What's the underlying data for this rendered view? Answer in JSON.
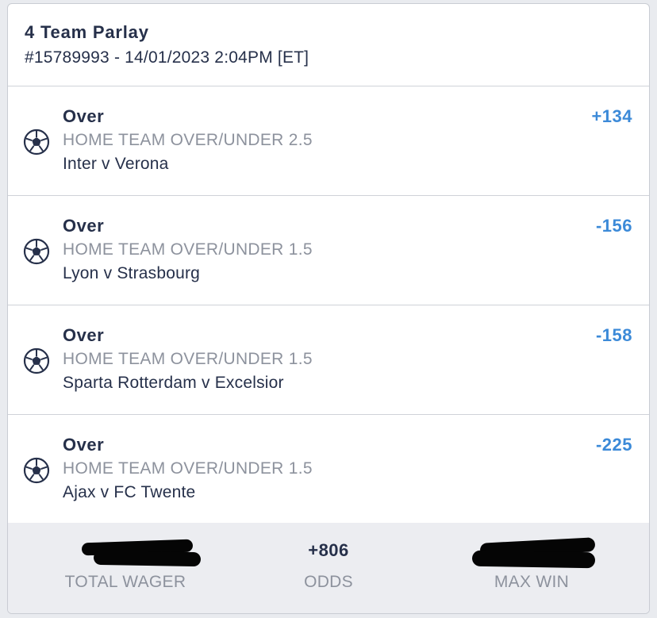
{
  "bet": {
    "title": "4 Team Parlay",
    "reference": "#15789993 - 14/01/2023 2:04PM [ET]"
  },
  "legs": [
    {
      "selection": "Over",
      "market": "HOME TEAM OVER/UNDER 2.5",
      "event": "Inter v Verona",
      "odds": "+134",
      "icon": "soccer-ball-icon"
    },
    {
      "selection": "Over",
      "market": "HOME TEAM OVER/UNDER 1.5",
      "event": "Lyon v Strasbourg",
      "odds": "-156",
      "icon": "soccer-ball-icon"
    },
    {
      "selection": "Over",
      "market": "HOME TEAM OVER/UNDER 1.5",
      "event": "Sparta Rotterdam v Excelsior",
      "odds": "-158",
      "icon": "soccer-ball-icon"
    },
    {
      "selection": "Over",
      "market": "HOME TEAM OVER/UNDER 1.5",
      "event": "Ajax v FC Twente",
      "odds": "-225",
      "icon": "soccer-ball-icon"
    }
  ],
  "summary": {
    "total_wager_label": "TOTAL WAGER",
    "total_wager_value": "",
    "odds_label": "ODDS",
    "odds_value": "+806",
    "max_win_label": "MAX WIN",
    "max_win_value": ""
  },
  "colors": {
    "odds_accent": "#3c8ad8",
    "text_primary": "#26304a",
    "text_secondary": "#8d929d",
    "footer_background": "#ecedf1",
    "redaction": "#050505"
  }
}
